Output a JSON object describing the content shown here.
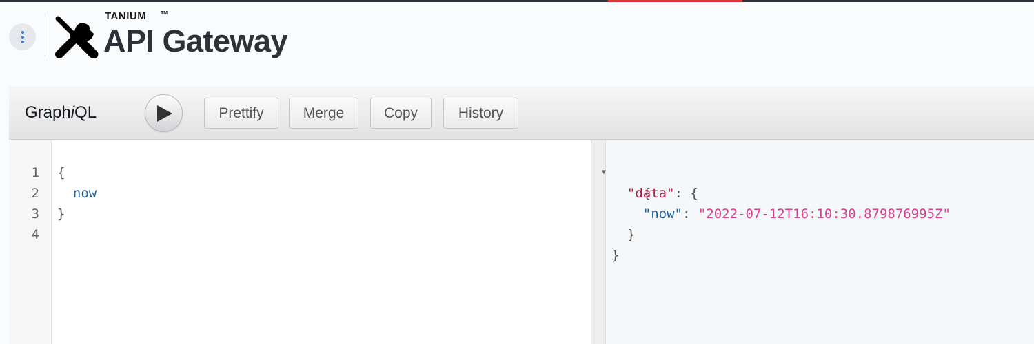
{
  "header": {
    "brand_small": "TANIUM",
    "brand_tm": "TM",
    "title": "API Gateway",
    "menu_icon": "vertical-dots-icon",
    "logo_icon": "wrench-screwdriver-icon"
  },
  "colors": {
    "top_accent": "#d63a3a",
    "keyword": "#1f61a0",
    "json_key": "#b11a4b",
    "json_string": "#d64292"
  },
  "toolbar": {
    "title_prefix": "Graph",
    "title_italic": "i",
    "title_suffix": "QL",
    "run_icon": "play-icon",
    "buttons": [
      {
        "label": "Prettify"
      },
      {
        "label": "Merge"
      },
      {
        "label": "Copy"
      },
      {
        "label": "History"
      }
    ]
  },
  "editor": {
    "lines": [
      {
        "number": "1",
        "text": "{"
      },
      {
        "number": "2",
        "text": "  ",
        "keyword": "now"
      },
      {
        "number": "3",
        "text": "}"
      },
      {
        "number": "4",
        "text": ""
      }
    ]
  },
  "result": {
    "open_brace": "{",
    "data_key": "\"data\"",
    "colon_open": ": {",
    "now_key": "\"now\"",
    "colon": ": ",
    "now_value": "\"2022-07-12T16:10:30.879876995Z\"",
    "inner_close": "}",
    "close_brace": "}",
    "fold_icon": "▼"
  }
}
